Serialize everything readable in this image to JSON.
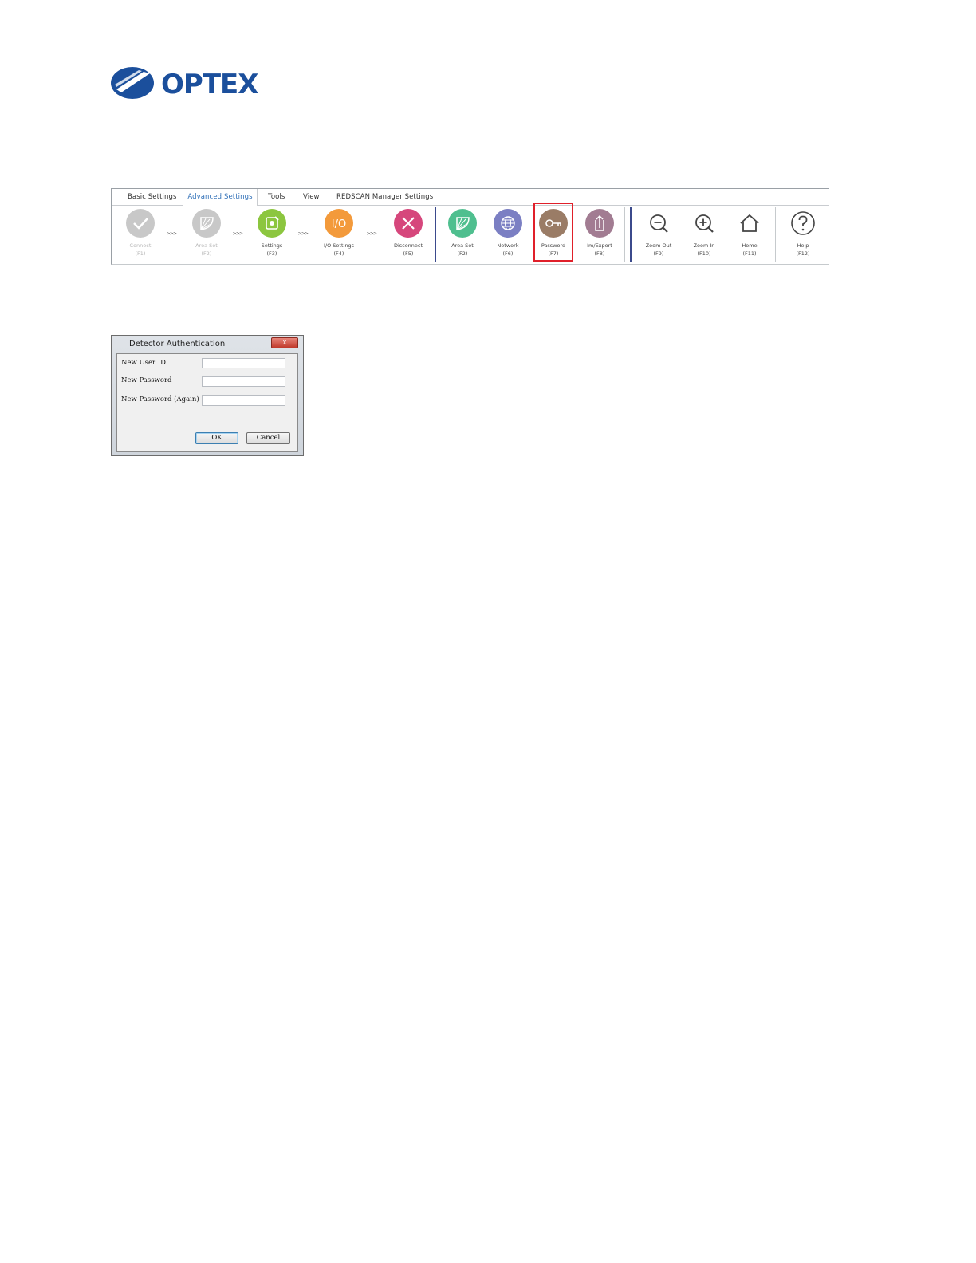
{
  "logo": {
    "brand": "OPTEX",
    "brand_color": "#1b4f9c"
  },
  "ribbon": {
    "tabs": [
      {
        "label": "Basic Settings"
      },
      {
        "label": "Advanced Settings",
        "active": true
      },
      {
        "label": "Tools"
      },
      {
        "label": "View"
      },
      {
        "label": "REDSCAN Manager Settings"
      }
    ],
    "buttons": [
      {
        "label": "Connect",
        "key": "(F1)",
        "icon": "check-icon",
        "color": "#c8c8c8",
        "disabled": true
      },
      {
        "label": "Area Set",
        "key": "(F2)",
        "icon": "area-icon",
        "color": "#c8c8c8",
        "disabled": true
      },
      {
        "label": "Settings",
        "key": "(F3)",
        "icon": "settings-icon",
        "color": "#8cc63f"
      },
      {
        "label": "I/O Settings",
        "key": "(F4)",
        "icon": "io-icon",
        "color": "#f39a3b"
      },
      {
        "label": "Disconnect",
        "key": "(F5)",
        "icon": "close-icon",
        "color": "#d6477c"
      },
      {
        "label": "Area Set",
        "key": "(F2)",
        "icon": "area-icon",
        "color": "#4fbf8f"
      },
      {
        "label": "Network",
        "key": "(F6)",
        "icon": "globe-icon",
        "color": "#7b7fc3"
      },
      {
        "label": "Password",
        "key": "(F7)",
        "icon": "key-icon",
        "color": "#9a7c66"
      },
      {
        "label": "Im/Export",
        "key": "(F8)",
        "icon": "export-icon",
        "color": "#a27c92"
      },
      {
        "label": "Zoom Out",
        "key": "(F9)",
        "icon": "zoom-out-icon"
      },
      {
        "label": "Zoom In",
        "key": "(F10)",
        "icon": "zoom-in-icon"
      },
      {
        "label": "Home",
        "key": "(F11)",
        "icon": "home-icon"
      },
      {
        "label": "Help",
        "key": "(F12)",
        "icon": "help-icon"
      }
    ],
    "step_arrow": ">>>",
    "highlight_color": "#e0202a"
  },
  "dialog": {
    "title": "Detector Authentication",
    "close_label": "x",
    "fields": [
      {
        "label": "New User ID",
        "value": ""
      },
      {
        "label": "New Password",
        "value": ""
      },
      {
        "label": "New Password (Again)",
        "value": ""
      }
    ],
    "ok_label": "OK",
    "cancel_label": "Cancel"
  }
}
